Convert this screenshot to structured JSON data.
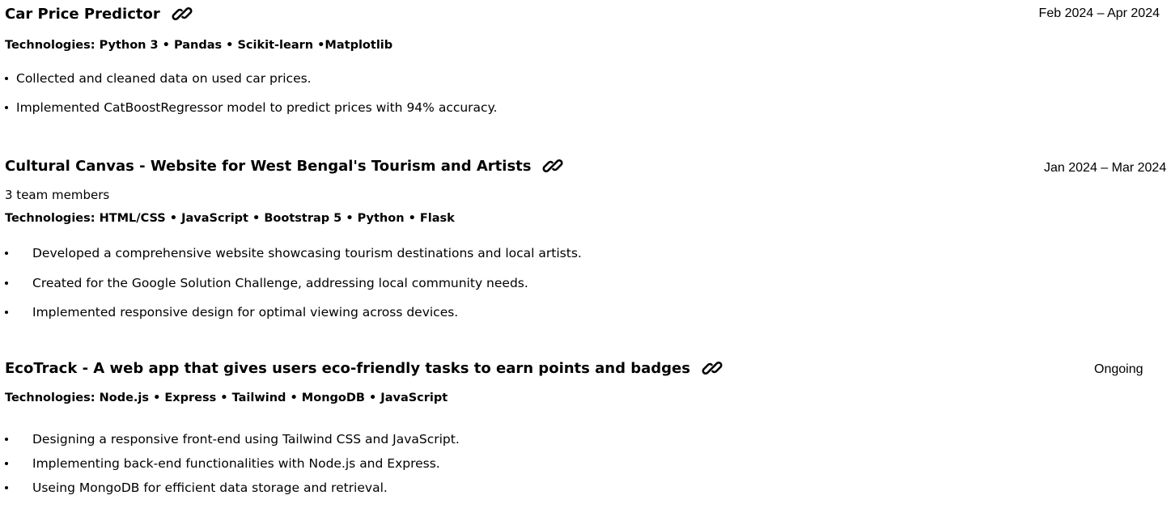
{
  "projects": [
    {
      "title": "Car Price Predictor",
      "date": "Feb 2024 – Apr 2024",
      "team": "",
      "technologies": "Technologies: Python 3 • Pandas • Scikit-learn •Matplotlib",
      "bullets": [
        "Collected and cleaned data on used car prices.",
        "Implemented CatBoostRegressor model to predict prices with 94% accuracy."
      ]
    },
    {
      "title": "Cultural Canvas - Website for West Bengal's Tourism and Artists",
      "date": "Jan 2024 – Mar 2024",
      "team": "3 team members",
      "technologies": "Technologies: HTML/CSS • JavaScript • Bootstrap 5 • Python • Flask",
      "bullets": [
        "Developed a comprehensive website showcasing tourism destinations and local artists.",
        "Created for the Google Solution Challenge, addressing local community needs.",
        "Implemented responsive design for optimal viewing across devices."
      ]
    },
    {
      "title": "EcoTrack - A web app that gives users eco-friendly tasks to earn points and badges",
      "date": "Ongoing",
      "team": "",
      "technologies": "Technologies: Node.js • Express • Tailwind • MongoDB • JavaScript",
      "bullets": [
        "Designing a responsive front-end using Tailwind CSS and JavaScript.",
        "Implementing back-end functionalities with Node.js and Express.",
        "Useing MongoDB for efficient data storage and retrieval."
      ]
    }
  ],
  "icons": {
    "link": "link-icon"
  }
}
